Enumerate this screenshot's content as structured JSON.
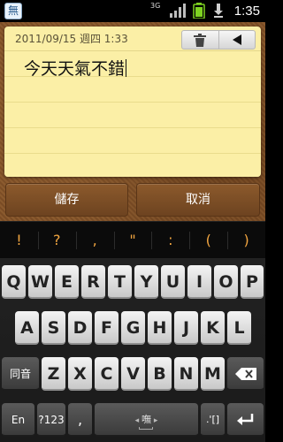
{
  "status_bar": {
    "network": "3G",
    "time": "1:35",
    "app_icon_glyph": "無",
    "icons": [
      "app-icon",
      "3g-data-icon",
      "signal-icon",
      "battery-icon",
      "download-icon"
    ]
  },
  "note": {
    "date": "2011/09/15 週四 1:33",
    "text": "今天天氣不錯",
    "delete_icon": "trash-icon",
    "back_icon": "back-arrow-icon"
  },
  "actions": {
    "save_label": "儲存",
    "cancel_label": "取消"
  },
  "suggestions": [
    "!",
    "?",
    ",",
    "\"",
    ":",
    "(",
    ")"
  ],
  "keyboard": {
    "row1": [
      "Q",
      "W",
      "E",
      "R",
      "T",
      "Y",
      "U",
      "I",
      "O",
      "P"
    ],
    "row2": [
      "A",
      "S",
      "D",
      "F",
      "G",
      "H",
      "J",
      "K",
      "L"
    ],
    "row3": [
      "Z",
      "X",
      "C",
      "V",
      "B",
      "N",
      "M"
    ],
    "shift_label": "同音",
    "backspace_icon": "backspace-icon",
    "lang_label": "En",
    "symbols_label": "?123",
    "comma_label": ",",
    "space_label": "嘸",
    "punct_label": ".'[]",
    "enter_icon": "enter-icon"
  },
  "colors": {
    "note_paper": "#fbefa6",
    "cork": "#805128",
    "suggestion_text": "#f1a540",
    "keyboard_bg": "#1a1a1a"
  }
}
